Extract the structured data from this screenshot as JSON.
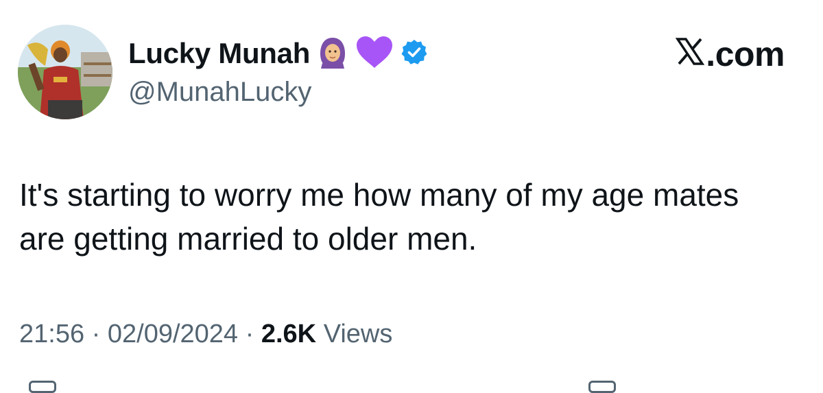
{
  "author": {
    "display_name": "Lucky Munah",
    "handle": "@MunahLucky",
    "verified": true,
    "name_emojis": [
      "woman-with-headscarf",
      "purple-heart"
    ],
    "badge_color": "#1d9bf0"
  },
  "brand": {
    "label": ".com",
    "logo": "x-logo"
  },
  "tweet": {
    "text": "It's starting to worry me how many of my age mates are getting married to older men."
  },
  "meta": {
    "time": "21:56",
    "separator": "·",
    "date": "02/09/2024",
    "views_count": "2.6K",
    "views_label": "Views"
  },
  "colors": {
    "text": "#0f1419",
    "secondary": "#536471",
    "verified": "#1d9bf0",
    "heart": "#a855f7"
  }
}
